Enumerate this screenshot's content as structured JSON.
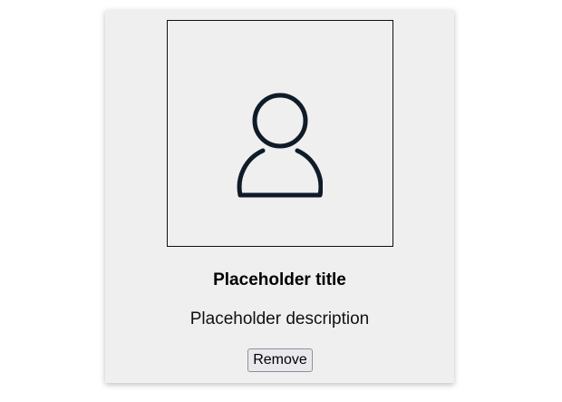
{
  "card": {
    "title": "Placeholder title",
    "description": "Placeholder description",
    "remove_label": "Remove",
    "avatar_icon": "person-icon",
    "icon_color": "#0f1b28"
  }
}
